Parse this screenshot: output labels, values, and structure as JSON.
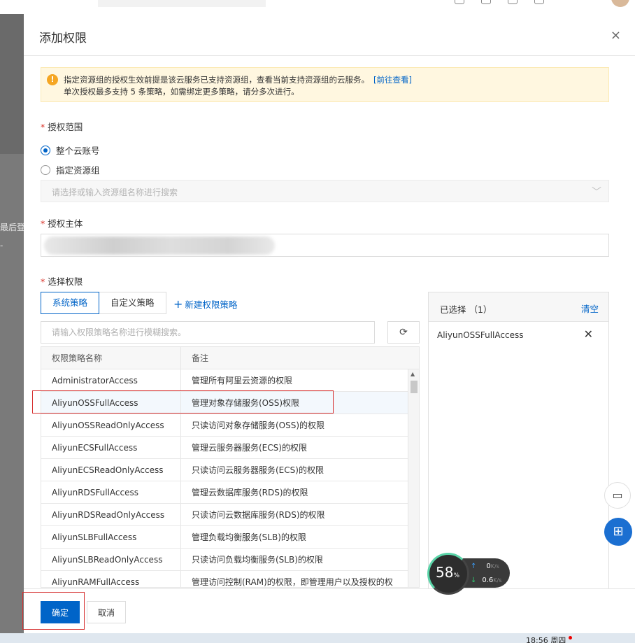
{
  "background": {
    "left_label": "最后登",
    "left_dash": "-"
  },
  "dialog": {
    "title": "添加权限",
    "close_symbol": "×"
  },
  "alert": {
    "icon": "!",
    "line1": "指定资源组的授权生效前提是该云服务已支持资源组，查看当前支持资源组的云服务。",
    "link": "[前往查看]",
    "line2": "单次授权最多支持 5 条策略，如需绑定更多策略，请分多次进行。"
  },
  "scope": {
    "label": "授权范围",
    "option_account": "整个云账号",
    "option_group": "指定资源组",
    "selected": "整个云账号",
    "group_placeholder": "请选择或输入资源组名称进行搜索"
  },
  "principal": {
    "label": "授权主体"
  },
  "permissions": {
    "label": "选择权限",
    "tab_system": "系统策略",
    "tab_custom": "自定义策略",
    "new_policy": "新建权限策略",
    "search_placeholder": "请输入权限策略名称进行模糊搜索。",
    "columns": [
      "权限策略名称",
      "备注"
    ],
    "rows": [
      [
        "AdministratorAccess",
        "管理所有阿里云资源的权限"
      ],
      [
        "AliyunOSSFullAccess",
        "管理对象存储服务(OSS)权限"
      ],
      [
        "AliyunOSSReadOnlyAccess",
        "只读访问对象存储服务(OSS)的权限"
      ],
      [
        "AliyunECSFullAccess",
        "管理云服务器服务(ECS)的权限"
      ],
      [
        "AliyunECSReadOnlyAccess",
        "只读访问云服务器服务(ECS)的权限"
      ],
      [
        "AliyunRDSFullAccess",
        "管理云数据库服务(RDS)的权限"
      ],
      [
        "AliyunRDSReadOnlyAccess",
        "只读访问云数据库服务(RDS)的权限"
      ],
      [
        "AliyunSLBFullAccess",
        "管理负载均衡服务(SLB)的权限"
      ],
      [
        "AliyunSLBReadOnlyAccess",
        "只读访问负载均衡服务(SLB)的权限"
      ],
      [
        "AliyunRAMFullAccess",
        "管理访问控制(RAM)的权限，即管理用户以及授权的权"
      ]
    ]
  },
  "selected_panel": {
    "title": "已选择 （1）",
    "clear": "清空",
    "items": [
      "AliyunOSSFullAccess"
    ],
    "remove_symbol": "✕"
  },
  "footer": {
    "ok": "确定",
    "cancel": "取消"
  },
  "net_widget": {
    "percent": "58",
    "percent_unit": "%",
    "up": "0",
    "down": "0.6",
    "unit": "K/s"
  },
  "taskbar": {
    "clock": "18:56 周四"
  },
  "colors": {
    "primary": "#0064c8",
    "warning_bg": "#fff7e0",
    "required": "#d93026",
    "highlight_box": "#d62f2f"
  }
}
